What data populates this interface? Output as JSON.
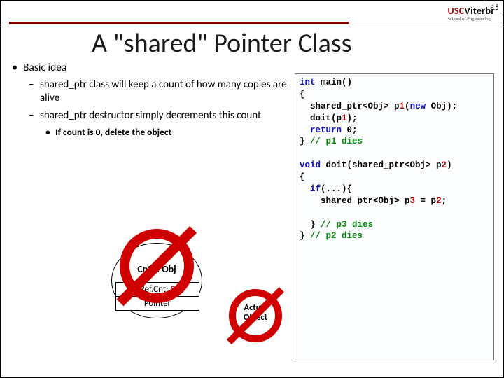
{
  "page_number": "15",
  "logo": {
    "usc": "USC",
    "viterbi": "Viterbi",
    "sub": "School of Engineering"
  },
  "title": "A \"shared\" Pointer Class",
  "bullets": {
    "lvl1": "Basic idea",
    "lvl2a": "shared_ptr class will keep a count of how many copies are alive",
    "lvl2b": "shared_ptr destructor simply decrements this count",
    "lvl3": "If count is 0, delete the object"
  },
  "diagram": {
    "ctrl_label": "Cntrl. Obj",
    "refcnt_label": "Ref.Cnt:",
    "refcnt_value": "0",
    "ptr_label": "Pointer",
    "actual_line1": "Actual",
    "actual_line2": "Object"
  },
  "code": {
    "l1a": "int",
    "l1b": " main()",
    "l2": "{",
    "l3a": "  shared_ptr<Obj> p",
    "l3b": "1",
    "l3c": "(",
    "l3d": "new",
    "l3e": " Obj);",
    "l4a": "  doit(p",
    "l4b": "1",
    "l4c": ");",
    "l5a": "  ",
    "l5b": "return",
    "l5c": " 0;",
    "l6a": "} ",
    "l6b": "// p1 dies",
    "l8a": "void",
    "l8b": " doit(shared_ptr<Obj> p",
    "l8c": "2",
    "l8d": ")",
    "l9": "{",
    "l10a": "  ",
    "l10b": "if",
    "l10c": "(...){",
    "l11a": "    shared_ptr<Obj> p",
    "l11b": "3",
    "l11c": " = p",
    "l11d": "2",
    "l11e": ";",
    "l13a": "  } ",
    "l13b": "// p3 dies",
    "l14a": "} ",
    "l14b": "// p2 dies"
  }
}
